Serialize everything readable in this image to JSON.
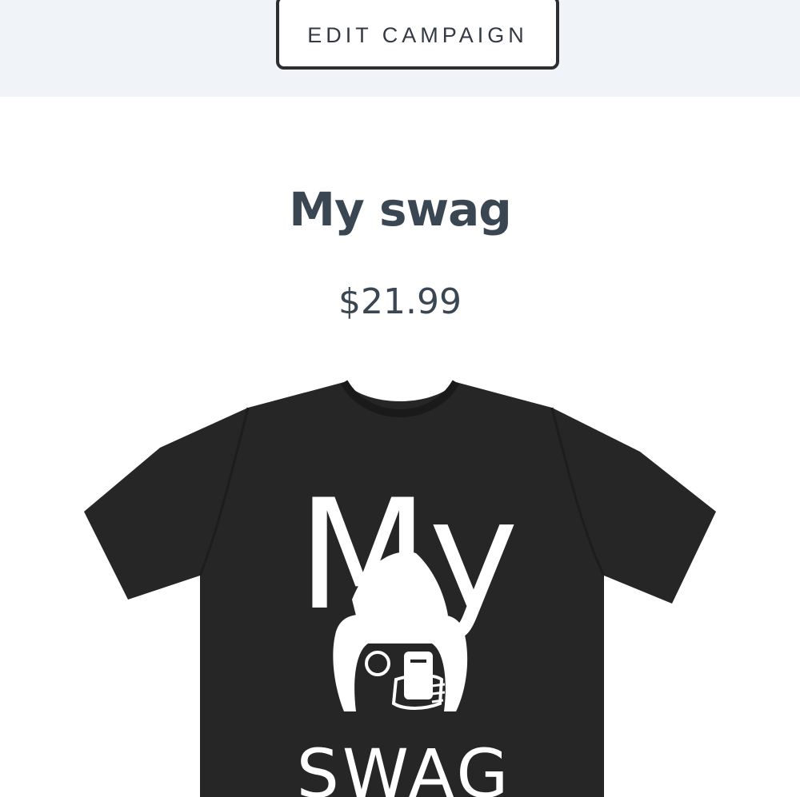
{
  "header": {
    "edit_campaign_label": "EDIT CAMPAIGN"
  },
  "product": {
    "title": "My swag",
    "price": "$21.99",
    "shirt_color": "#262626",
    "print_text_top": "My",
    "print_text_bottom": "SWAG"
  },
  "colors": {
    "topbar_bg": "#f0f3f7",
    "text_dark": "#3a4652",
    "button_border": "#2e2e2e"
  }
}
